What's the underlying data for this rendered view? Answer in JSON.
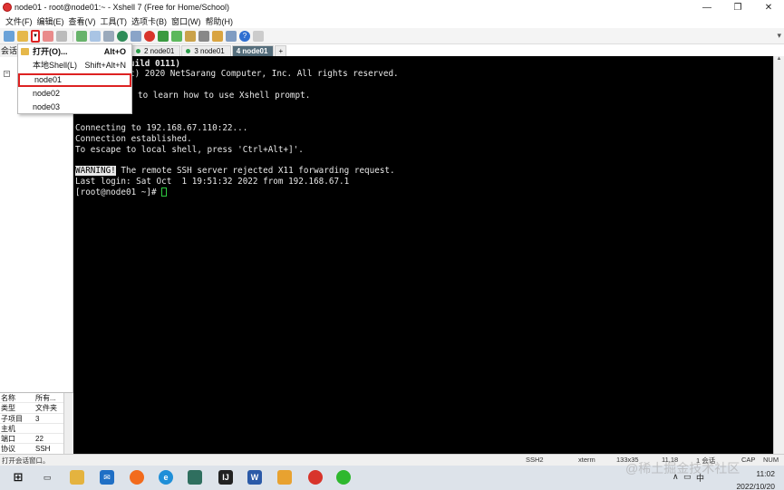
{
  "window": {
    "title": "node01 - root@node01:~ - Xshell 7 (Free for Home/School)"
  },
  "menu": [
    "文件(F)",
    "编辑(E)",
    "查看(V)",
    "工具(T)",
    "选项卡(B)",
    "窗口(W)",
    "帮助(H)"
  ],
  "sidebar": {
    "header": "会话"
  },
  "tabs": [
    "2 node01",
    "3 node01",
    "4 node01"
  ],
  "dropdown": {
    "items": [
      {
        "label": "打开(O)...",
        "shortcut": "Alt+O"
      },
      {
        "label": "本地Shell(L)",
        "shortcut": "Shift+Alt+N"
      },
      {
        "label": "node01"
      },
      {
        "label": "node02"
      },
      {
        "label": "node03"
      }
    ]
  },
  "terminal": {
    "lines": [
      "uild 0111)",
      "c) 2020 NetSarang Computer, Inc. All rights reserved.",
      "to learn how to use Xshell prompt.",
      "Connecting to 192.168.67.110:22...",
      "Connection established.",
      "To escape to local shell, press 'Ctrl+Alt+]'.",
      "WARNING!",
      " The remote SSH server rejected X11 forwarding request.",
      "Last login: Sat Oct  1 19:51:32 2022 from 192.168.67.1",
      "[root@node01 ~]# "
    ]
  },
  "properties": {
    "rows": [
      {
        "name": "名称",
        "value": "所有..."
      },
      {
        "name": "类型",
        "value": "文件夹"
      },
      {
        "name": "子项目",
        "value": "3"
      },
      {
        "name": "主机",
        "value": ""
      },
      {
        "name": "端口",
        "value": "22"
      },
      {
        "name": "协议",
        "value": "SSH"
      }
    ]
  },
  "status": {
    "left": "打开会话窗口。",
    "protocol": "SSH2",
    "term": "xterm",
    "size": "133x35",
    "pos": "11,18",
    "sessions": "1 会话",
    "caps": "CAP",
    "num": "NUM"
  },
  "taskbar": {
    "ime": "中",
    "time": "11:02",
    "date": "2022/10/20"
  },
  "watermark": "@稀土掘金技术社区"
}
